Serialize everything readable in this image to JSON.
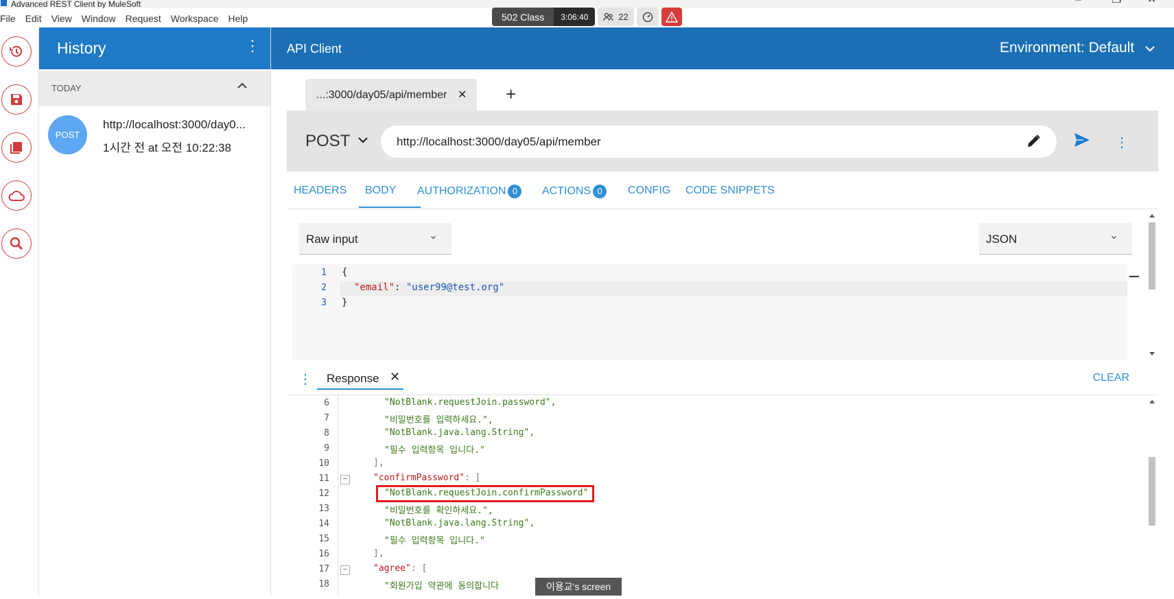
{
  "window": {
    "title": "Advanced REST Client by MuleSoft"
  },
  "menu": [
    "File",
    "Edit",
    "View",
    "Window",
    "Request",
    "Workspace",
    "Help"
  ],
  "meeting_bar": {
    "label": "502 Class",
    "timer": "3:06:40",
    "participants": "22"
  },
  "rail": [
    {
      "icon": "history-icon"
    },
    {
      "icon": "save-icon"
    },
    {
      "icon": "library-icon"
    },
    {
      "icon": "cloud-icon"
    },
    {
      "icon": "search-icon"
    }
  ],
  "history": {
    "title": "History",
    "group_label": "TODAY",
    "items": [
      {
        "method": "POST",
        "url": "http://localhost:3000/day0...",
        "time": "1시간 전 at 오전 10:22:38"
      }
    ]
  },
  "header": {
    "title": "API Client",
    "environment": "Environment: Default"
  },
  "tabs": [
    {
      "label": "...:3000/day05/api/member"
    }
  ],
  "request": {
    "method": "POST",
    "url": "http://localhost:3000/day05/api/member"
  },
  "subtabs": {
    "headers": "HEADERS",
    "body": "BODY",
    "authorization": "AUTHORIZATION",
    "authorization_count": "0",
    "actions": "ACTIONS",
    "actions_count": "0",
    "config": "CONFIG",
    "snippets": "CODE SNIPPETS"
  },
  "body": {
    "input_type": "Raw input",
    "content_type": "JSON",
    "lines": [
      {
        "num": "1",
        "text": "{"
      },
      {
        "num": "2",
        "key": "\"email\"",
        "sep": ": ",
        "value": "\"user99@test.org\""
      },
      {
        "num": "3",
        "text": "}"
      }
    ]
  },
  "response": {
    "tab_label": "Response",
    "clear_label": "CLEAR",
    "lines": [
      {
        "num": "6",
        "text": "\"NotBlank.requestJoin.password\","
      },
      {
        "num": "7",
        "text": "\"비밀번호를 입력하세요.\","
      },
      {
        "num": "8",
        "text": "\"NotBlank.java.lang.String\","
      },
      {
        "num": "9",
        "text": "\"필수 입력항목 입니다.\""
      },
      {
        "num": "10",
        "text": "],"
      },
      {
        "num": "11",
        "key": "\"confirmPassword\"",
        "text": ": ["
      },
      {
        "num": "12",
        "text": "\"NotBlank.requestJoin.confirmPassword\""
      },
      {
        "num": "13",
        "text": "\"비밀번호를 확인하세요.\","
      },
      {
        "num": "14",
        "text": "\"NotBlank.java.lang.String\","
      },
      {
        "num": "15",
        "text": "\"필수 입력항목 입니다.\""
      },
      {
        "num": "16",
        "text": "],"
      },
      {
        "num": "17",
        "key": "\"agree\"",
        "text": ": ["
      },
      {
        "num": "18",
        "text": "\"회원가입 약관에 동의합니다"
      }
    ]
  },
  "screen_tag": "이용교's screen",
  "colors": {
    "accent": "#1a6fb5",
    "link": "#2e90d6",
    "highlight": "#e21b1b"
  }
}
